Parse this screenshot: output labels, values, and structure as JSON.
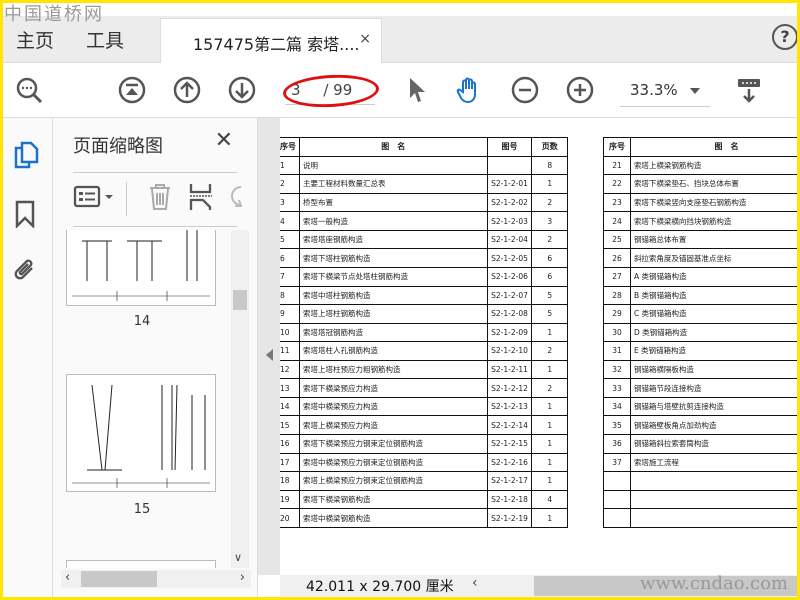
{
  "watermarks": {
    "top": "中国道桥网",
    "bottom": "www.cndao.com"
  },
  "nav": {
    "home": "主页",
    "tools": "工具",
    "help": "?"
  },
  "doc_tab": {
    "title": "157475第二篇 索塔....",
    "close": "×"
  },
  "toolbar": {
    "current_page": "3",
    "total_pages": "/ 99",
    "zoom": "33.3%",
    "active_tool": "hand-tool"
  },
  "sidebar": {
    "title": "页面缩略图",
    "close": "✕",
    "thumbnails": [
      {
        "label": "14"
      },
      {
        "label": "15"
      }
    ]
  },
  "status": {
    "dimensions": "42.011 x 29.700 厘米"
  },
  "colors": {
    "accent": "#1a73c8",
    "highlight_oval": "#e01010",
    "frame": "#ffe600"
  },
  "left_table": {
    "headers": [
      "序号",
      "图　名",
      "图号",
      "页数"
    ],
    "rows": [
      [
        "1",
        "说明",
        "",
        "8"
      ],
      [
        "2",
        "主要工程材料数量汇总表",
        "S2-1-2-01",
        "1"
      ],
      [
        "3",
        "桥型布置",
        "S2-1-2-02",
        "2"
      ],
      [
        "4",
        "索塔一般构造",
        "S2-1-2-03",
        "3"
      ],
      [
        "5",
        "索塔塔座钢筋构造",
        "S2-1-2-04",
        "2"
      ],
      [
        "6",
        "索塔下塔柱钢筋构造",
        "S2-1-2-05",
        "6"
      ],
      [
        "7",
        "索塔下横梁节点处塔柱钢筋构造",
        "S2-1-2-06",
        "6"
      ],
      [
        "8",
        "索塔中塔柱钢筋构造",
        "S2-1-2-07",
        "5"
      ],
      [
        "9",
        "索塔上塔柱钢筋构造",
        "S2-1-2-08",
        "5"
      ],
      [
        "10",
        "索塔塔冠钢筋构造",
        "S2-1-2-09",
        "1"
      ],
      [
        "11",
        "索塔塔柱人孔钢筋构造",
        "S2-1-2-10",
        "2"
      ],
      [
        "12",
        "索塔上塔柱预应力粗钢筋构造",
        "S2-1-2-11",
        "1"
      ],
      [
        "13",
        "索塔下横梁预应力构造",
        "S2-1-2-12",
        "2"
      ],
      [
        "14",
        "索塔中横梁预应力构造",
        "S2-1-2-13",
        "1"
      ],
      [
        "15",
        "索塔上横梁预应力构造",
        "S2-1-2-14",
        "1"
      ],
      [
        "16",
        "索塔下横梁预应力钢束定位钢筋构造",
        "S2-1-2-15",
        "1"
      ],
      [
        "17",
        "索塔中横梁预应力钢束定位钢筋构造",
        "S2-1-2-16",
        "1"
      ],
      [
        "18",
        "索塔上横梁预应力钢束定位钢筋构造",
        "S2-1-2-17",
        "1"
      ],
      [
        "19",
        "索塔下横梁钢筋构造",
        "S2-1-2-18",
        "4"
      ],
      [
        "20",
        "索塔中横梁钢筋构造",
        "S2-1-2-19",
        "1"
      ]
    ]
  },
  "right_table": {
    "headers": [
      "序号",
      "图　名"
    ],
    "rows": [
      [
        "21",
        "索塔上横梁钢筋构造"
      ],
      [
        "22",
        "索塔下横梁垫石、挡块总体布置"
      ],
      [
        "23",
        "索塔下横梁竖向支座垫石钢筋构造"
      ],
      [
        "24",
        "索塔下横梁横向挡块钢筋构造"
      ],
      [
        "25",
        "钢锚箱总体布置"
      ],
      [
        "26",
        "斜拉索角度及锚固基准点坐标"
      ],
      [
        "27",
        "A 类钢锚箱构造"
      ],
      [
        "28",
        "B 类钢锚箱构造"
      ],
      [
        "29",
        "C 类钢锚箱构造"
      ],
      [
        "30",
        "D 类钢锚箱构造"
      ],
      [
        "31",
        "E 类钢锚箱构造"
      ],
      [
        "32",
        "钢锚箱横隔板构造"
      ],
      [
        "33",
        "钢锚箱节段连接构造"
      ],
      [
        "34",
        "钢锚箱与塔壁抗剪连接构造"
      ],
      [
        "35",
        "钢锚箱壁板角点加劲构造"
      ],
      [
        "36",
        "钢锚箱斜拉索套筒构造"
      ],
      [
        "37",
        "索塔施工流程"
      ],
      [
        "",
        ""
      ],
      [
        "",
        ""
      ],
      [
        "",
        ""
      ]
    ]
  }
}
